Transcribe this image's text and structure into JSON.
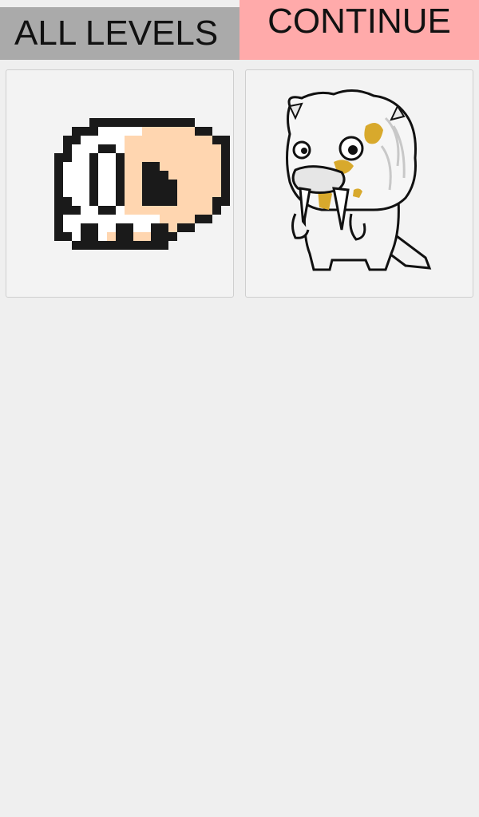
{
  "header": {
    "all_levels_label": "ALL LEVELS",
    "continue_label": "CONTINUE"
  },
  "colors": {
    "background": "#efefef",
    "all_levels_button": "#aaaaaa",
    "continue_button": "#ffaaaa",
    "card_background": "#f3f3f3",
    "card_border": "#cfcfcf"
  },
  "levels": [
    {
      "sprite": "pixel-skull-icon"
    },
    {
      "sprite": "white-walrus-monster-icon"
    }
  ]
}
